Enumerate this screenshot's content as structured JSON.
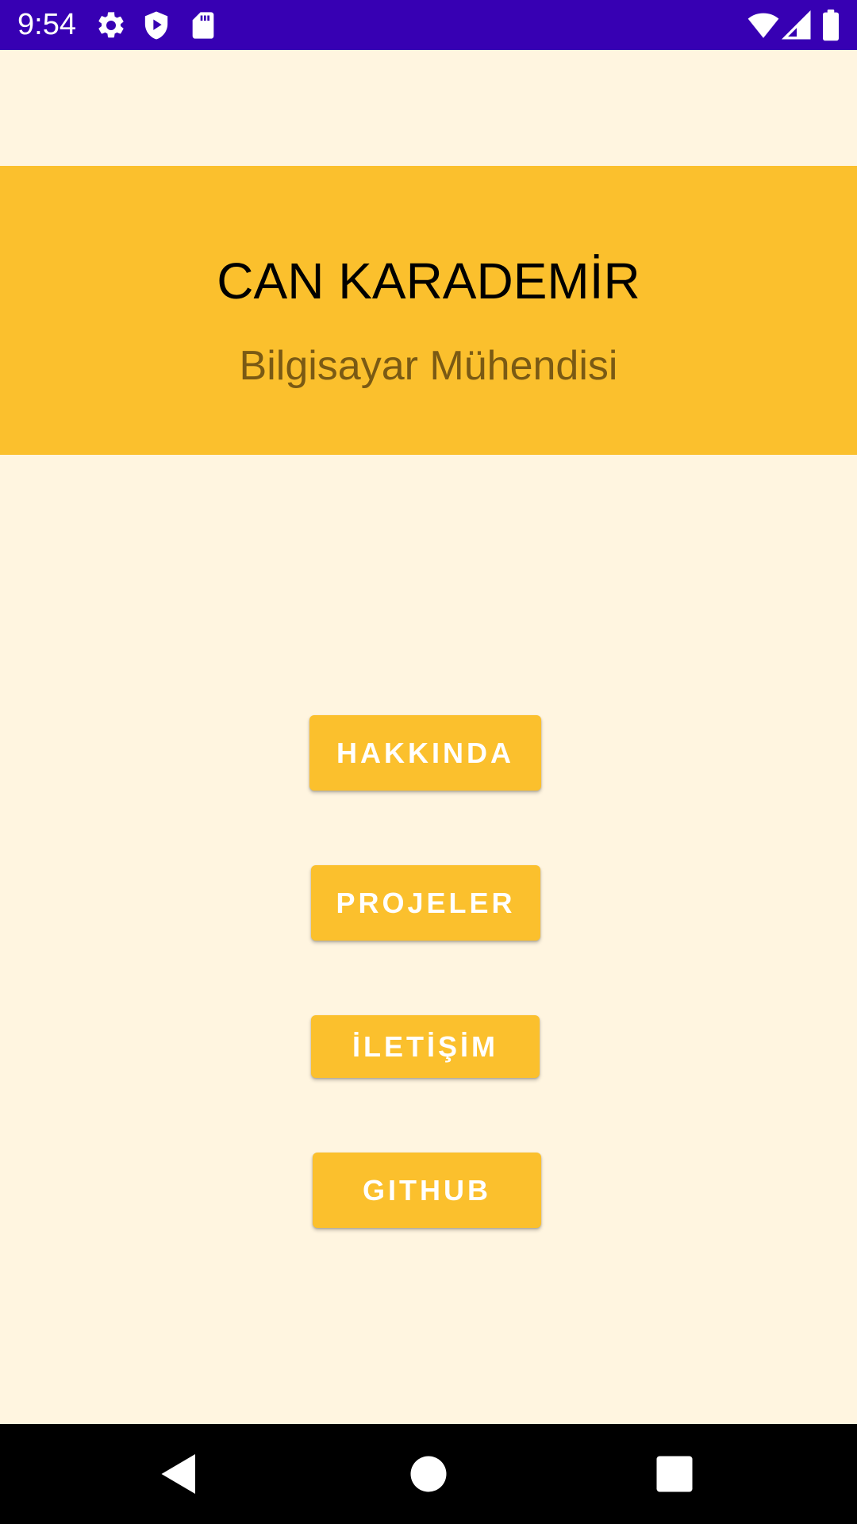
{
  "status_bar": {
    "time": "9:54",
    "icons": [
      "gear-icon",
      "shield-play-icon",
      "sd-card-icon",
      "wifi-icon",
      "cell-signal-icon",
      "battery-icon"
    ],
    "background": "#3700B3"
  },
  "header": {
    "name": "CAN KARADEMİR",
    "title": "Bilgisayar Mühendisi",
    "background": "#FBC02D"
  },
  "buttons": {
    "about": "HAKKINDA",
    "projects": "PROJELER",
    "contact": "İLETİŞİM",
    "github": "GITHUB"
  },
  "nav_bar": {
    "icons": [
      "back-icon",
      "home-icon",
      "recents-icon"
    ]
  },
  "colors": {
    "page_background": "#FFF5E0",
    "accent": "#FBC02D",
    "subtitle": "#7A5A14"
  }
}
